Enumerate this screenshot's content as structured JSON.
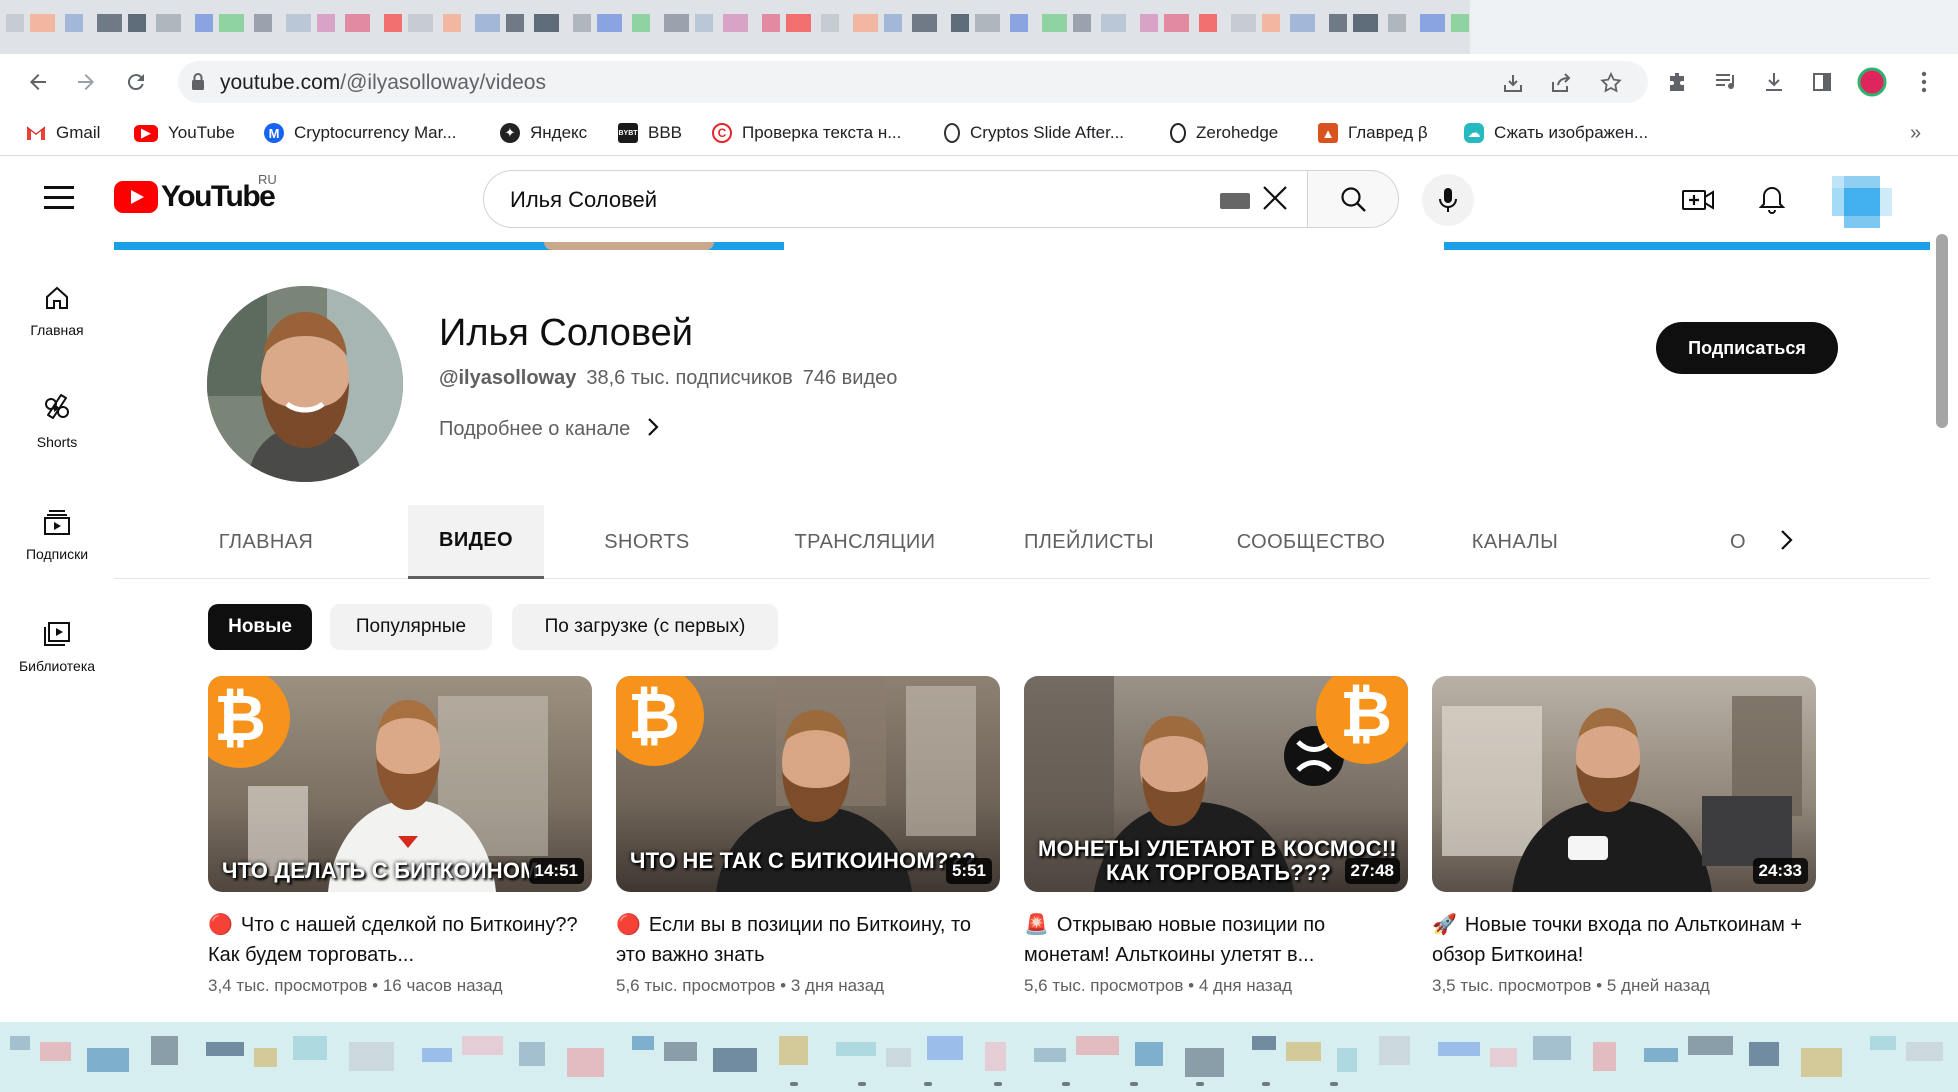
{
  "browser": {
    "url_host": "youtube.com",
    "url_path": "/@ilyasolloway/videos",
    "bookmarks": [
      {
        "label": "Gmail",
        "icon": "gmail-icon",
        "color": "#ea4335"
      },
      {
        "label": "YouTube",
        "icon": "youtube-icon",
        "color": "#ff0000"
      },
      {
        "label": "Cryptocurrency Mar...",
        "icon": "coinmarketcap-icon",
        "color": "#1763f1"
      },
      {
        "label": "Яндекс",
        "icon": "yandex-icon",
        "color": "#222222"
      },
      {
        "label": "BBB",
        "icon": "bybit-icon",
        "color": "#1a1a1a"
      },
      {
        "label": "Проверка текста н...",
        "icon": "text-check-icon",
        "color": "#e3262b"
      },
      {
        "label": "Cryptos Slide After...",
        "icon": "article-icon",
        "color": "#333333"
      },
      {
        "label": "Zerohedge",
        "icon": "zerohedge-icon",
        "color": "#222222"
      },
      {
        "label": "Главред β",
        "icon": "glavred-icon",
        "color": "#d9531e"
      },
      {
        "label": "Сжать изображен...",
        "icon": "compress-image-icon",
        "color": "#26b9c2"
      }
    ],
    "bookmarks_overflow": "»"
  },
  "youtube": {
    "logo_text": "YouTube",
    "region": "RU",
    "search_query": "Илья Соловей",
    "guide": [
      {
        "label": "Главная",
        "icon": "home-icon"
      },
      {
        "label": "Shorts",
        "icon": "shorts-icon"
      },
      {
        "label": "Подписки",
        "icon": "subscriptions-icon"
      },
      {
        "label": "Библиотека",
        "icon": "library-icon"
      }
    ]
  },
  "channel": {
    "name": "Илья Соловей",
    "handle": "@ilyasolloway",
    "subscribers": "38,6 тыс. подписчиков",
    "video_count": "746 видео",
    "more_about": "Подробнее о канале",
    "subscribe_label": "Подписаться",
    "tabs": [
      "ГЛАВНАЯ",
      "ВИДЕО",
      "SHORTS",
      "ТРАНСЛЯЦИИ",
      "ПЛЕЙЛИСТЫ",
      "СООБЩЕСТВО",
      "КАНАЛЫ",
      "О"
    ],
    "active_tab": "ВИДЕО",
    "chips": [
      "Новые",
      "Популярные",
      "По загрузке (с первых)"
    ],
    "active_chip": "Новые"
  },
  "videos": [
    {
      "title": "Что с нашей сделкой по Биткоину?? Как будем торговать...",
      "emoji": "🔴",
      "thumb_caption": "ЧТО ДЕЛАТЬ С БИТКОИНОМ",
      "duration": "14:51",
      "views": "3,4 тыс. просмотров",
      "age": "16 часов назад"
    },
    {
      "title": "Если вы в позиции по Биткоину, то это важно знать",
      "emoji": "🔴",
      "thumb_caption": "ЧТО НЕ ТАК С БИТКОИНОМ???",
      "duration": "5:51",
      "views": "5,6 тыс. просмотров",
      "age": "3 дня назад"
    },
    {
      "title": "Открываю новые позиции по монетам! Альткоины улетят в...",
      "emoji": "🚨",
      "thumb_caption": "МОНЕТЫ УЛЕТАЮТ В КОСМОС!!",
      "thumb_caption_2": "КАК ТОРГОВАТЬ???",
      "duration": "27:48",
      "views": "5,6 тыс. просмотров",
      "age": "4 дня назад"
    },
    {
      "title": "Новые точки входа по Альткоинам + обзор Биткоина!",
      "emoji": "🚀",
      "thumb_caption": "",
      "duration": "24:33",
      "views": "3,5 тыс. просмотров",
      "age": "5 дней назад"
    }
  ],
  "meta_separator": "•",
  "colors": {
    "brand_red": "#ff0000",
    "bitcoin_orange": "#f7931a",
    "banner_blue": "#1ba0e8",
    "text_primary": "#0f0f0f",
    "text_secondary": "#606060"
  }
}
